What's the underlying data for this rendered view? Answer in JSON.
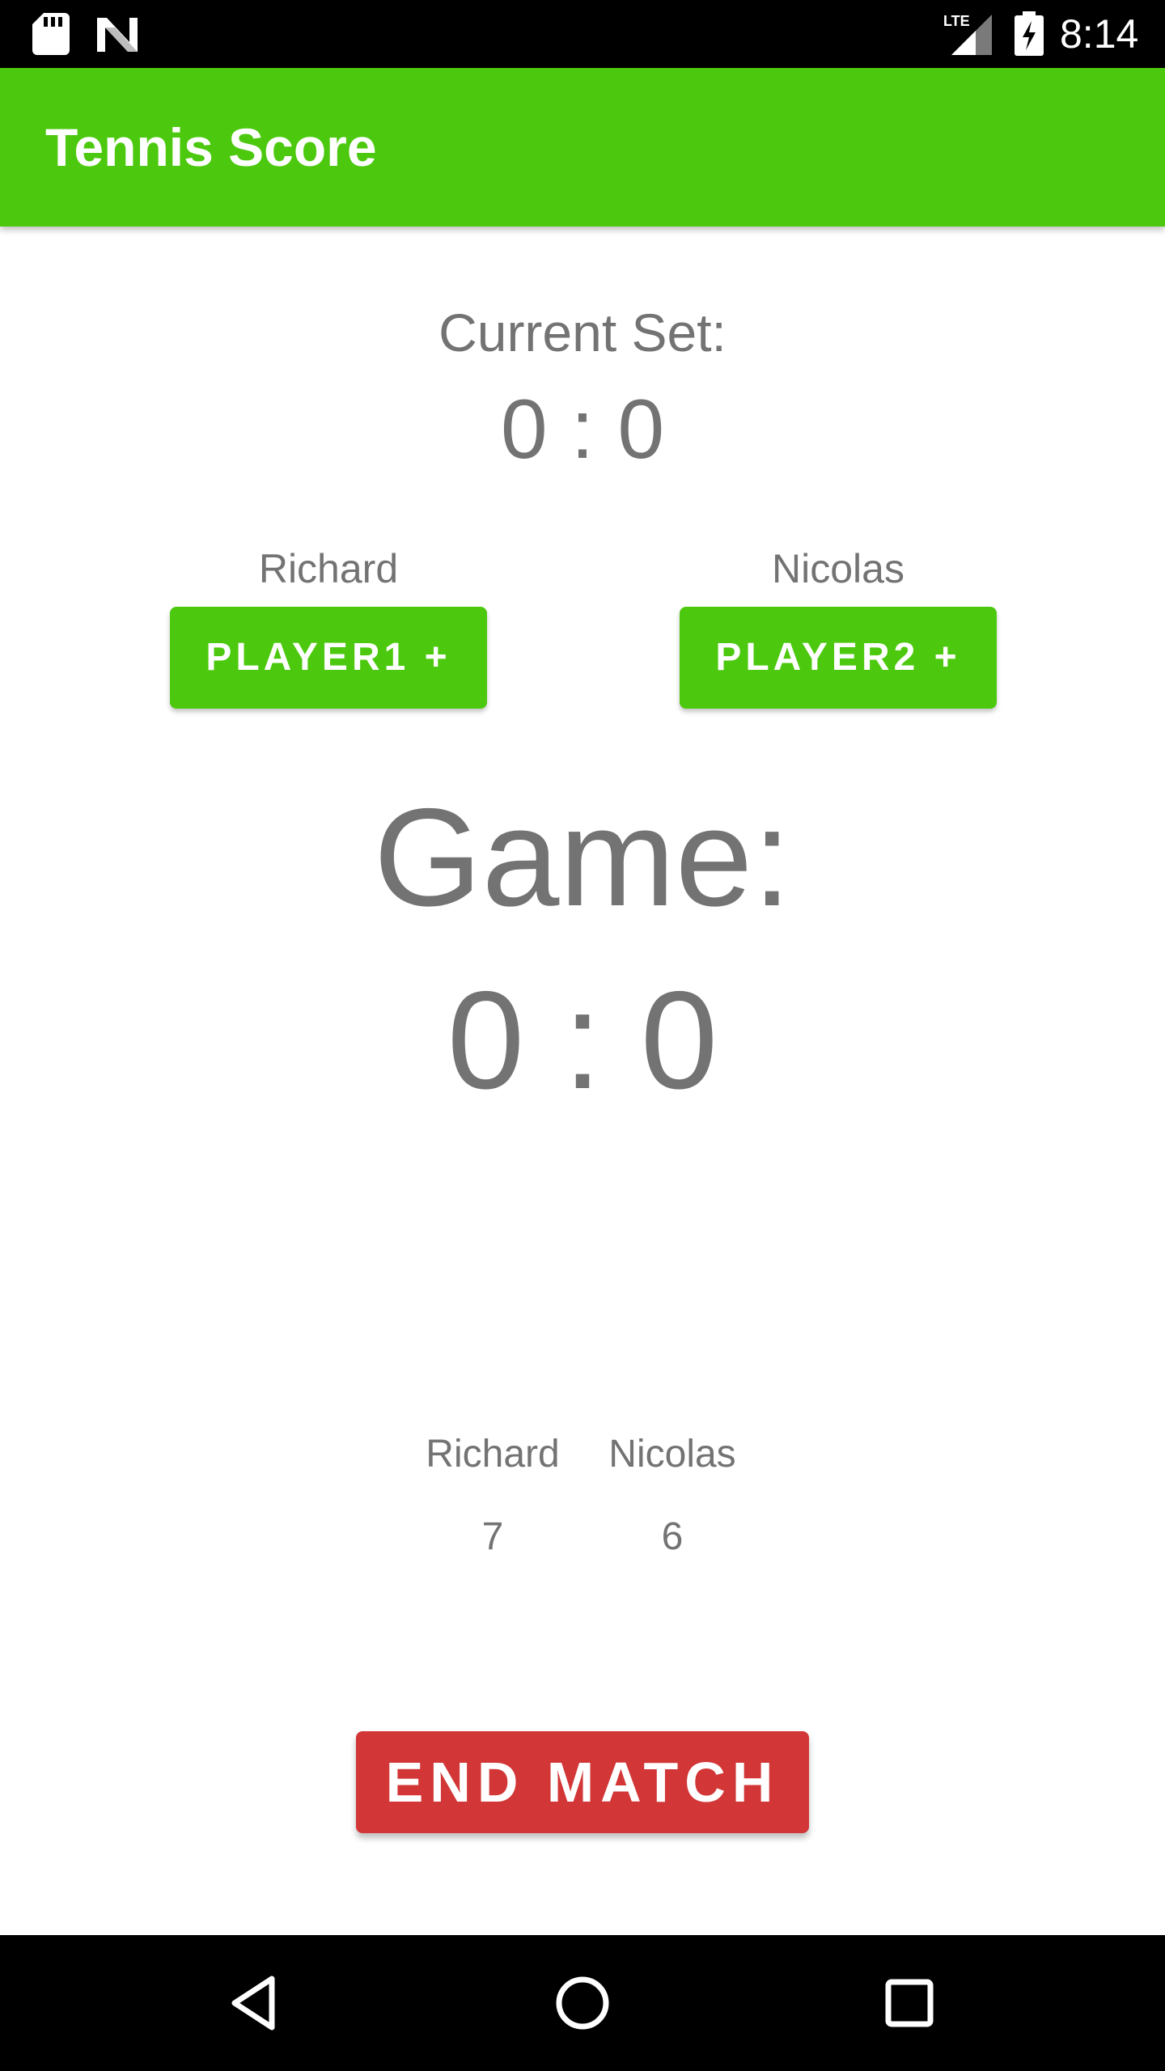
{
  "status_bar": {
    "time": "8:14",
    "network": "LTE",
    "icons": [
      "sd-card-icon",
      "n-notification-icon",
      "signal-icon",
      "battery-charging-icon"
    ]
  },
  "app_bar": {
    "title": "Tennis Score"
  },
  "current_set": {
    "label": "Current Set:",
    "score": "0 : 0"
  },
  "players": [
    {
      "name": "Richard",
      "button_label": "PLAYER1 +"
    },
    {
      "name": "Nicolas",
      "button_label": "PLAYER2 +"
    }
  ],
  "game": {
    "label": "Game:",
    "score": "0 : 0"
  },
  "set_history": {
    "headers": [
      "Richard",
      "Nicolas"
    ],
    "rows": [
      [
        "7",
        "6"
      ]
    ]
  },
  "end_match": {
    "label": "END MATCH"
  },
  "nav_bar": {
    "icons": [
      "back-icon",
      "home-icon",
      "recents-icon"
    ]
  },
  "colors": {
    "accent": "#4cc90e",
    "end_button": "#d23636",
    "text": "#737373"
  }
}
